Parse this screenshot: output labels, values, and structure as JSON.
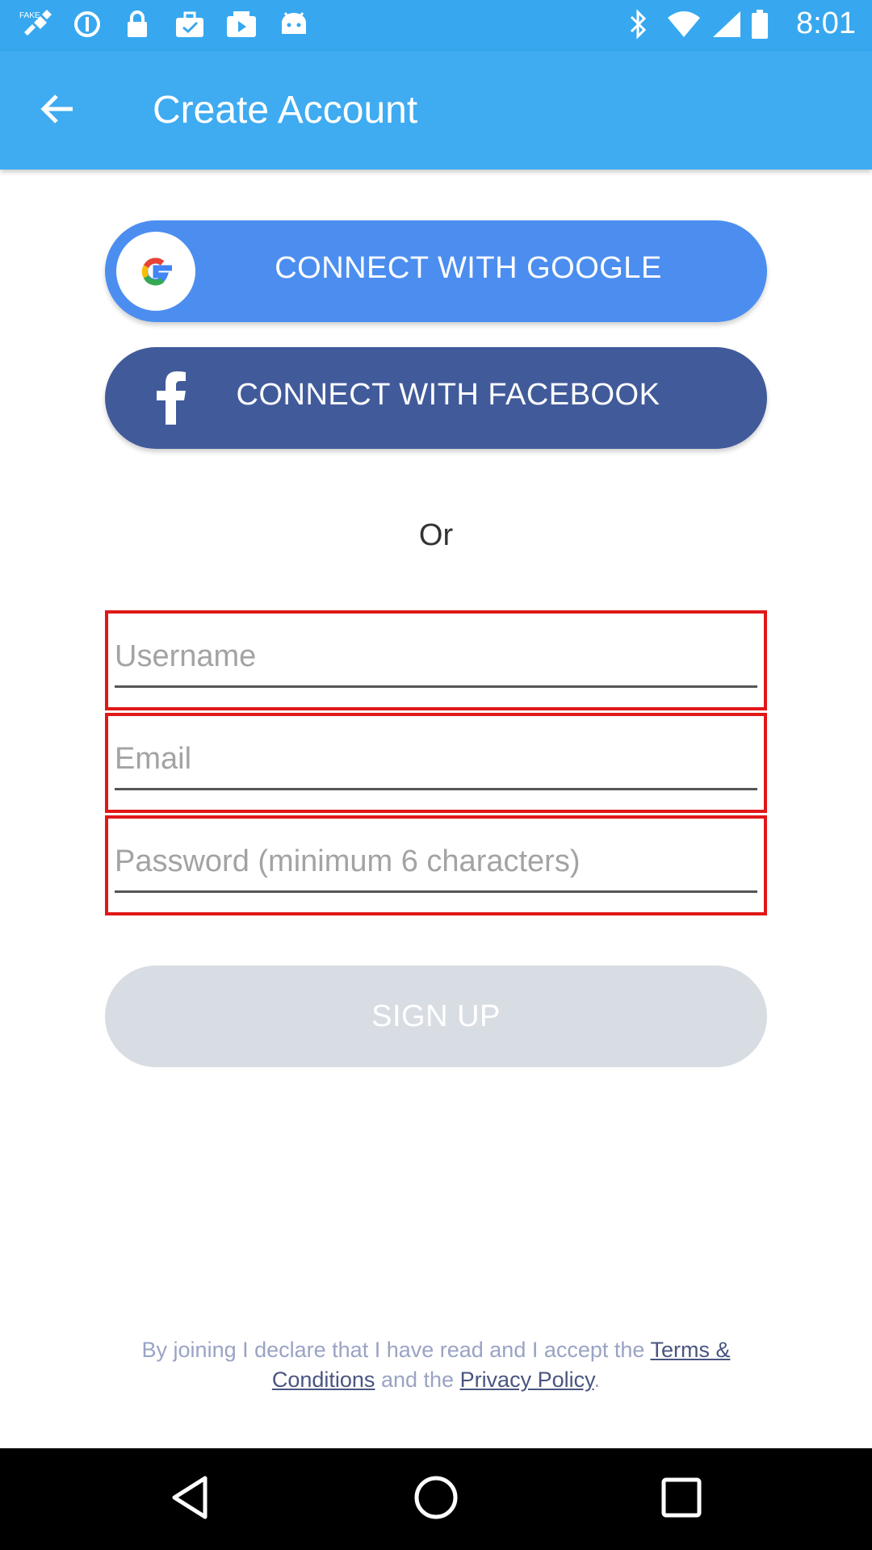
{
  "status_bar": {
    "time": "8:01",
    "left_icons": [
      "fake-gps-icon",
      "data-saver-icon",
      "lock-icon",
      "briefcase-check-icon",
      "youtube-icon",
      "android-icon"
    ],
    "right_icons": [
      "bluetooth-icon",
      "wifi-icon",
      "signal-icon",
      "battery-icon"
    ]
  },
  "app_bar": {
    "title": "Create Account",
    "back_icon": "arrow-back-icon",
    "color": "#3fabf1"
  },
  "social": {
    "google_label": "CONNECT WITH GOOGLE",
    "google_color": "#4c8ef0",
    "facebook_label": "CONNECT WITH FACEBOOK",
    "facebook_color": "#415a9a"
  },
  "separator": "Or",
  "form": {
    "username_placeholder": "Username",
    "username_value": "",
    "email_placeholder": "Email",
    "email_value": "",
    "password_placeholder": "Password (minimum 6 characters)",
    "password_value": "",
    "error_border_color": "#e01818"
  },
  "signup": {
    "label": "SIGN UP",
    "disabled_color": "#d8dde3"
  },
  "terms": {
    "prefix": "By joining I declare that I have read and I accept the",
    "terms_link": "Terms & Conditions",
    "middle": "and the",
    "privacy_link": "Privacy Policy",
    "suffix": "."
  },
  "nav_bar": {
    "icons": [
      "back-triangle-icon",
      "home-circle-icon",
      "recents-square-icon"
    ]
  }
}
